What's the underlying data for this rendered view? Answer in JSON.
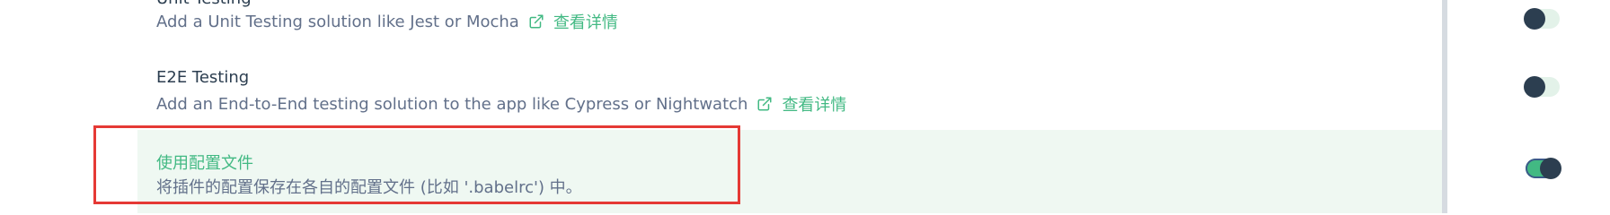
{
  "features": [
    {
      "title": "Unit Testing",
      "description": "Add a Unit Testing solution like Jest or Mocha",
      "link_label": "查看详情",
      "enabled": false
    },
    {
      "title": "E2E Testing",
      "description": "Add an End-to-End testing solution to the app like Cypress or Nightwatch",
      "link_label": "查看详情",
      "enabled": false
    },
    {
      "title": "使用配置文件",
      "description": "将插件的配置保存在各自的配置文件 (比如 '.babelrc') 中。",
      "enabled": true
    }
  ],
  "colors": {
    "accent": "#42b983",
    "title_text": "#2c3e50",
    "description_text": "#62708a",
    "selected_row_bg": "#eff8f2",
    "highlight_border": "#e53935"
  },
  "icons": {
    "external_link": "external-link-icon"
  }
}
